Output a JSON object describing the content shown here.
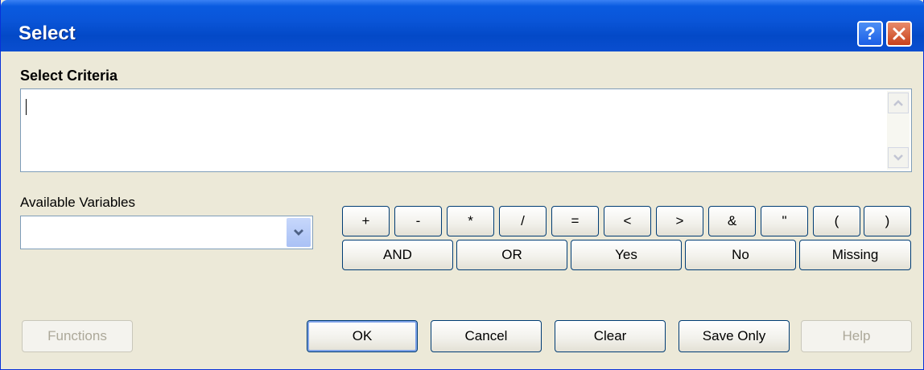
{
  "window": {
    "title": "Select"
  },
  "titlebar_buttons": {
    "help": "?",
    "close_icon": "close-x-icon"
  },
  "criteria": {
    "label": "Select Criteria",
    "value": ""
  },
  "variables": {
    "label": "Available Variables",
    "selected": ""
  },
  "operators": {
    "row1": [
      "+",
      "-",
      "*",
      "/",
      "=",
      "<",
      ">",
      "&",
      "\"",
      "(",
      ")"
    ],
    "row2": [
      "AND",
      "OR",
      "Yes",
      "No",
      "Missing"
    ]
  },
  "buttons": {
    "functions": "Functions",
    "ok": "OK",
    "cancel": "Cancel",
    "clear": "Clear",
    "save_only": "Save Only",
    "help": "Help"
  },
  "colors": {
    "title_bar": "#0a55d8",
    "dialog_bg": "#ece9d8",
    "button_border": "#003c74"
  }
}
